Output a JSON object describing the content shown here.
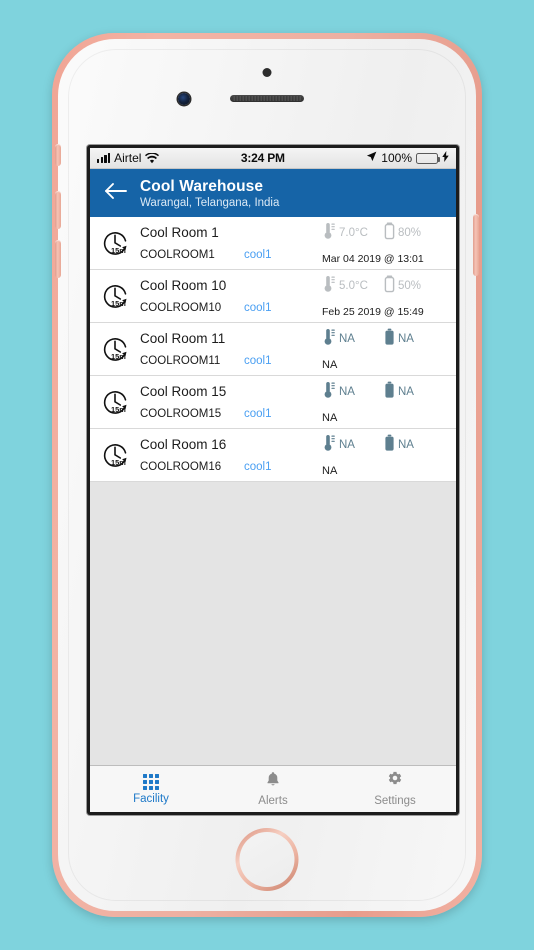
{
  "status_bar": {
    "carrier": "Airtel",
    "wifi_icon": "wifi-icon",
    "signal_icon": "signal-bars-icon",
    "time": "3:24 PM",
    "location_icon": "location-arrow-icon",
    "battery_percent": "100%",
    "battery_icon": "battery-full-icon",
    "charging_icon": "lightning-bolt-icon",
    "battery_color": "#3ad13a"
  },
  "header": {
    "back_icon": "back-arrow-icon",
    "title": "Cool Warehouse",
    "subtitle": "Warangal, Telangana, India",
    "background_color": "#1664a7"
  },
  "list": {
    "interval_icon": "clock-refresh-icon",
    "interval_label": "15m",
    "temperature_icon": "thermometer-icon",
    "battery_icon": "battery-icon",
    "rows": [
      {
        "name": "Cool Room 1",
        "code": "COOLROOM1",
        "tag": "cool1",
        "interval": "15m",
        "temperature": "7.0°C",
        "battery": "80%",
        "timestamp": "Mar 04 2019 @ 13:01",
        "state": "dim"
      },
      {
        "name": "Cool Room 10",
        "code": "COOLROOM10",
        "tag": "cool1",
        "interval": "15m",
        "temperature": "5.0°C",
        "battery": "50%",
        "timestamp": "Feb 25 2019 @ 15:49",
        "state": "dim"
      },
      {
        "name": "Cool Room 11",
        "code": "COOLROOM11",
        "tag": "cool1",
        "interval": "15m",
        "temperature": "NA",
        "battery": "NA",
        "timestamp": "NA",
        "state": "slate"
      },
      {
        "name": "Cool Room 15",
        "code": "COOLROOM15",
        "tag": "cool1",
        "interval": "15m",
        "temperature": "NA",
        "battery": "NA",
        "timestamp": "NA",
        "state": "slate"
      },
      {
        "name": "Cool Room 16",
        "code": "COOLROOM16",
        "tag": "cool1",
        "interval": "15m",
        "temperature": "NA",
        "battery": "NA",
        "timestamp": "NA",
        "state": "slate"
      }
    ]
  },
  "tabbar": {
    "active": "Facility",
    "active_color": "#1e79c8",
    "inactive_color": "#8c8c8c",
    "tabs": [
      {
        "label": "Facility",
        "icon": "grid-icon"
      },
      {
        "label": "Alerts",
        "icon": "bell-icon"
      },
      {
        "label": "Settings",
        "icon": "gear-icon"
      }
    ]
  },
  "theme": {
    "page_background": "#7fd3dd",
    "link_color": "#4a9ff2",
    "list_background": "#e4e4e4"
  }
}
